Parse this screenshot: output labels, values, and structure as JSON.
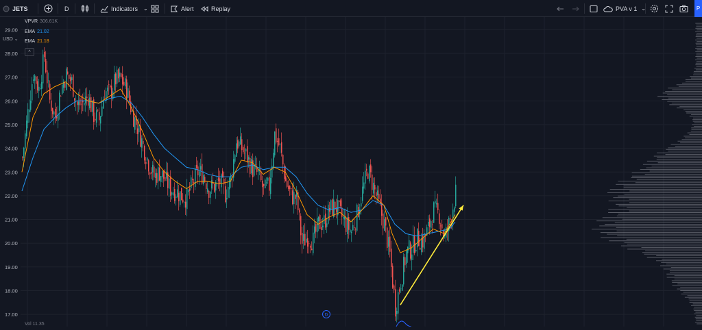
{
  "toolbar": {
    "symbol": "JETS",
    "interval": "D",
    "indicators_label": "Indicators",
    "alert_label": "Alert",
    "replay_label": "Replay",
    "layout_name": "PVA v 1",
    "edge_button": "P"
  },
  "legend": {
    "currency": "USD",
    "vpvr_name": "VPVR",
    "vpvr_value": "306.61K",
    "ema1_name": "EMA",
    "ema1_value": "21.02",
    "ema1_color": "#2196f3",
    "ema2_name": "EMA",
    "ema2_value": "21.18",
    "ema2_color": "#ff9800",
    "collapse_symbol": "^"
  },
  "volume_label": "Vol 11.35",
  "event_marker": "D",
  "icons": [
    "add-icon",
    "candle-icon",
    "indicators-icon",
    "templates-icon",
    "alert-icon",
    "replay-icon",
    "undo-icon",
    "redo-icon",
    "rectangle-icon",
    "cloud-icon",
    "settings-icon",
    "fullscreen-icon",
    "camera-icon"
  ],
  "chart_data": {
    "type": "candlestick",
    "y_ticks": [
      "29.00",
      "28.00",
      "27.00",
      "26.00",
      "25.00",
      "24.00",
      "23.00",
      "22.00",
      "21.00",
      "20.00",
      "19.00",
      "18.00",
      "17.00"
    ],
    "ylim": [
      16.6,
      29.3
    ],
    "up_color": "#26a69a",
    "down_color": "#ef5350",
    "arrow_color": "#ffeb3b",
    "close_path": [
      [
        0,
        23.6
      ],
      [
        4,
        25.5
      ],
      [
        8,
        27.2
      ],
      [
        12,
        26.5
      ],
      [
        16,
        27.9
      ],
      [
        20,
        26.0
      ],
      [
        24,
        25.3
      ],
      [
        28,
        26.5
      ],
      [
        32,
        27.1
      ],
      [
        36,
        26.8
      ],
      [
        40,
        25.8
      ],
      [
        44,
        25.9
      ],
      [
        48,
        26.2
      ],
      [
        52,
        25.4
      ],
      [
        56,
        25.2
      ],
      [
        60,
        26.4
      ],
      [
        64,
        26.3
      ],
      [
        68,
        26.9
      ],
      [
        72,
        26.9
      ],
      [
        76,
        26.5
      ],
      [
        80,
        25.5
      ],
      [
        84,
        24.9
      ],
      [
        88,
        24.1
      ],
      [
        92,
        23.4
      ],
      [
        96,
        22.8
      ],
      [
        100,
        23.0
      ],
      [
        104,
        22.7
      ],
      [
        108,
        22.3
      ],
      [
        112,
        22.2
      ],
      [
        116,
        22.0
      ],
      [
        120,
        21.9
      ],
      [
        124,
        22.5
      ],
      [
        128,
        23.0
      ],
      [
        132,
        22.9
      ],
      [
        136,
        22.3
      ],
      [
        140,
        22.4
      ],
      [
        144,
        22.6
      ],
      [
        148,
        22.1
      ],
      [
        152,
        22.7
      ],
      [
        156,
        24.3
      ],
      [
        160,
        24.0
      ],
      [
        164,
        23.6
      ],
      [
        168,
        23.1
      ],
      [
        172,
        22.9
      ],
      [
        176,
        22.2
      ],
      [
        180,
        22.4
      ],
      [
        184,
        24.6
      ],
      [
        188,
        24.0
      ],
      [
        192,
        22.6
      ],
      [
        196,
        22.0
      ],
      [
        200,
        21.9
      ],
      [
        204,
        20.0
      ],
      [
        208,
        20.3
      ],
      [
        212,
        20.1
      ],
      [
        216,
        20.8
      ],
      [
        220,
        20.9
      ],
      [
        224,
        21.4
      ],
      [
        228,
        21.6
      ],
      [
        232,
        21.2
      ],
      [
        236,
        20.8
      ],
      [
        240,
        20.5
      ],
      [
        244,
        21.2
      ],
      [
        248,
        22.2
      ],
      [
        252,
        23.1
      ],
      [
        256,
        22.4
      ],
      [
        260,
        21.6
      ],
      [
        264,
        20.8
      ],
      [
        268,
        19.5
      ],
      [
        272,
        17.3
      ],
      [
        276,
        18.4
      ],
      [
        280,
        19.6
      ],
      [
        284,
        19.8
      ],
      [
        288,
        20.2
      ],
      [
        292,
        20.1
      ],
      [
        296,
        20.6
      ],
      [
        300,
        21.4
      ],
      [
        304,
        21.2
      ],
      [
        308,
        20.2
      ],
      [
        312,
        21.0
      ],
      [
        316,
        22.1
      ]
    ],
    "ema_short_path": [
      [
        0,
        23.0
      ],
      [
        8,
        25.3
      ],
      [
        16,
        26.3
      ],
      [
        24,
        26.6
      ],
      [
        32,
        26.8
      ],
      [
        40,
        26.3
      ],
      [
        48,
        26.0
      ],
      [
        56,
        25.9
      ],
      [
        64,
        26.2
      ],
      [
        72,
        26.5
      ],
      [
        80,
        25.7
      ],
      [
        88,
        24.7
      ],
      [
        96,
        23.6
      ],
      [
        104,
        23.0
      ],
      [
        112,
        22.6
      ],
      [
        120,
        22.3
      ],
      [
        128,
        22.6
      ],
      [
        136,
        22.6
      ],
      [
        144,
        22.5
      ],
      [
        152,
        22.6
      ],
      [
        160,
        23.5
      ],
      [
        168,
        23.4
      ],
      [
        176,
        22.9
      ],
      [
        184,
        23.2
      ],
      [
        192,
        23.0
      ],
      [
        200,
        22.2
      ],
      [
        208,
        21.2
      ],
      [
        216,
        20.8
      ],
      [
        224,
        21.1
      ],
      [
        232,
        21.3
      ],
      [
        240,
        20.9
      ],
      [
        248,
        21.4
      ],
      [
        256,
        22.0
      ],
      [
        264,
        21.6
      ],
      [
        270,
        20.4
      ],
      [
        276,
        19.6
      ],
      [
        284,
        19.8
      ],
      [
        292,
        20.2
      ],
      [
        300,
        20.6
      ],
      [
        308,
        20.4
      ],
      [
        316,
        21.2
      ]
    ],
    "ema_long_path": [
      [
        0,
        22.2
      ],
      [
        8,
        23.6
      ],
      [
        16,
        24.8
      ],
      [
        24,
        25.3
      ],
      [
        32,
        25.7
      ],
      [
        40,
        26.0
      ],
      [
        48,
        26.0
      ],
      [
        56,
        25.9
      ],
      [
        64,
        26.1
      ],
      [
        72,
        26.2
      ],
      [
        80,
        25.9
      ],
      [
        88,
        25.3
      ],
      [
        96,
        24.6
      ],
      [
        104,
        24.0
      ],
      [
        112,
        23.6
      ],
      [
        120,
        23.2
      ],
      [
        128,
        23.1
      ],
      [
        136,
        22.9
      ],
      [
        144,
        22.8
      ],
      [
        152,
        22.8
      ],
      [
        160,
        23.2
      ],
      [
        168,
        23.3
      ],
      [
        176,
        23.1
      ],
      [
        184,
        23.2
      ],
      [
        192,
        23.2
      ],
      [
        200,
        22.8
      ],
      [
        208,
        22.1
      ],
      [
        216,
        21.6
      ],
      [
        224,
        21.4
      ],
      [
        232,
        21.5
      ],
      [
        240,
        21.3
      ],
      [
        248,
        21.4
      ],
      [
        256,
        21.8
      ],
      [
        264,
        21.6
      ],
      [
        272,
        20.8
      ],
      [
        280,
        20.4
      ],
      [
        288,
        20.3
      ],
      [
        296,
        20.4
      ],
      [
        304,
        20.5
      ],
      [
        312,
        20.6
      ],
      [
        316,
        20.9
      ]
    ],
    "trend_arrow": {
      "from": [
        276,
        17.4
      ],
      "to": [
        322,
        21.6
      ]
    }
  }
}
